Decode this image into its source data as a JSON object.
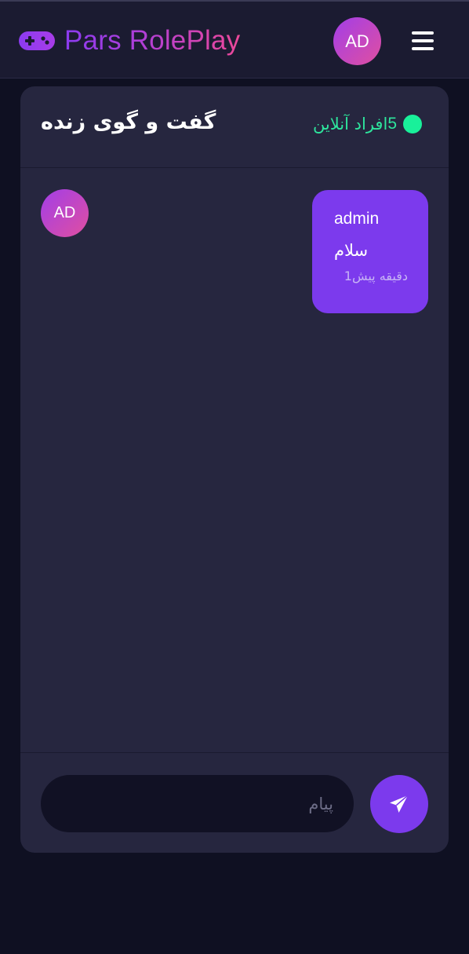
{
  "navbar": {
    "brand": "Pars RolePlay",
    "brand_icon": "gamepad-icon",
    "avatar_initials": "AD",
    "menu_icon": "hamburger-menu-icon"
  },
  "chat": {
    "title": "گفت و گوی زنده",
    "online_label": "افراد آنلاین",
    "online_count": "5",
    "messages": [
      {
        "avatar_initials": "AD",
        "author": "admin",
        "text": "سلام",
        "time": "دقیقه پیش1"
      }
    ],
    "input_placeholder": "پیام",
    "input_value": "",
    "send_icon": "paper-plane-icon"
  },
  "colors": {
    "page_background": "#0f1022",
    "navbar_background": "#1b1b31",
    "card_background": "#26263f",
    "accent_purple": "#7c3aed",
    "brand_gradient_start": "#8b3bf0",
    "brand_gradient_end": "#ec4899",
    "online_green": "#19f09a",
    "input_background": "#111124"
  }
}
